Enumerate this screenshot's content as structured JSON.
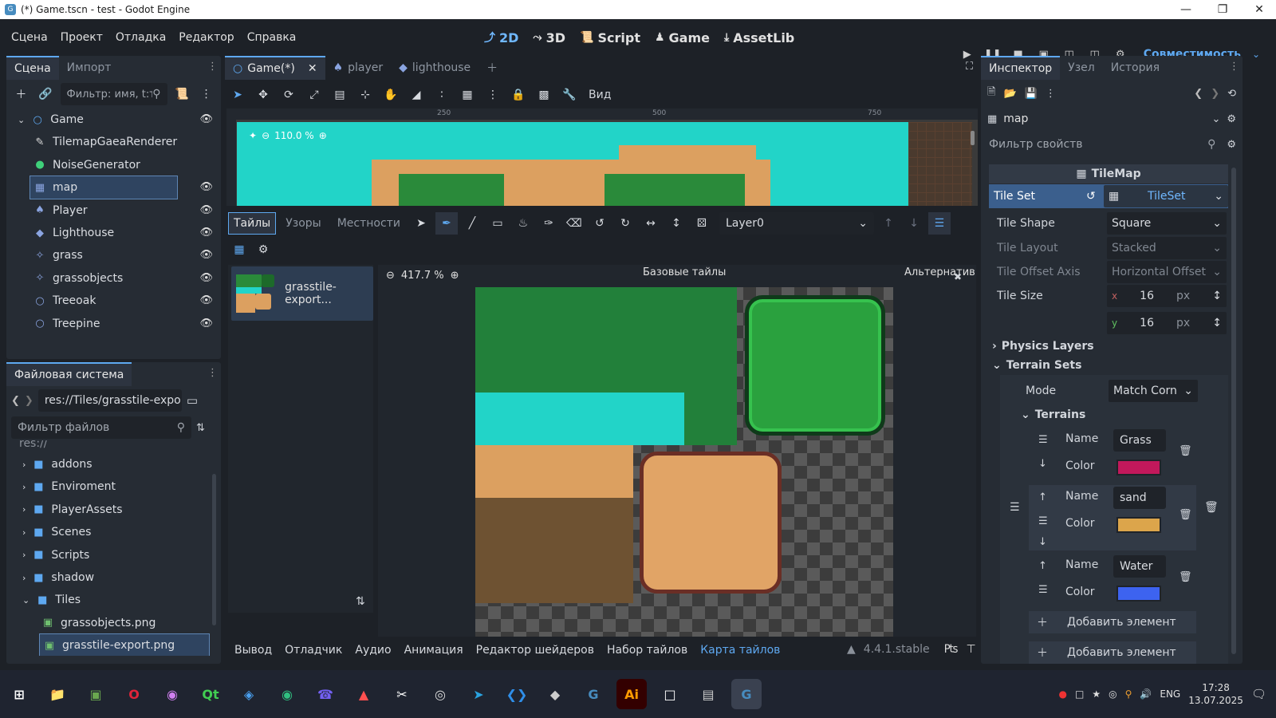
{
  "window": {
    "title": "(*) Game.tscn - test - Godot Engine"
  },
  "menu": {
    "items": [
      "Сцена",
      "Проект",
      "Отладка",
      "Редактор",
      "Справка"
    ]
  },
  "workspaces": [
    {
      "label": "2D",
      "icon": "2d-icon"
    },
    {
      "label": "3D",
      "icon": "3d-icon"
    },
    {
      "label": "Script",
      "icon": "script-icon"
    },
    {
      "label": "Game",
      "icon": "game-icon"
    },
    {
      "label": "AssetLib",
      "icon": "assetlib-icon"
    }
  ],
  "renderer": "Совместимость",
  "scene_panel": {
    "tabs": [
      "Сцена",
      "Импорт"
    ],
    "filter_placeholder": "Фильтр: имя, t:т",
    "nodes": [
      {
        "name": "Game",
        "depth": 0
      },
      {
        "name": "TilemapGaeaRenderer",
        "depth": 1
      },
      {
        "name": "NoiseGenerator",
        "depth": 1
      },
      {
        "name": "map",
        "depth": 1,
        "selected": true
      },
      {
        "name": "Player",
        "depth": 1
      },
      {
        "name": "Lighthouse",
        "depth": 1
      },
      {
        "name": "grass",
        "depth": 1
      },
      {
        "name": "grassobjects",
        "depth": 1
      },
      {
        "name": "Treeoak",
        "depth": 1
      },
      {
        "name": "Treepine",
        "depth": 1
      }
    ]
  },
  "filesystem": {
    "title": "Файловая система",
    "path": "res://Tiles/grasstile-export.",
    "filter_placeholder": "Фильтр файлов",
    "root": "res://",
    "items": [
      {
        "name": "addons",
        "type": "folder"
      },
      {
        "name": "Enviroment",
        "type": "folder"
      },
      {
        "name": "PlayerAssets",
        "type": "folder"
      },
      {
        "name": "Scenes",
        "type": "folder"
      },
      {
        "name": "Scripts",
        "type": "folder"
      },
      {
        "name": "shadow",
        "type": "folder"
      },
      {
        "name": "Tiles",
        "type": "folder"
      },
      {
        "name": "grassobjects.png",
        "type": "file"
      },
      {
        "name": "grasstile-export.png",
        "type": "file",
        "selected": true
      }
    ]
  },
  "editor_tabs": [
    "Game(*)",
    "player",
    "lighthouse"
  ],
  "toolbar": {
    "view_label": "Вид"
  },
  "viewport": {
    "zoom": "110.0 %",
    "ruler_marks": [
      "250",
      "500",
      "750"
    ]
  },
  "tilemap_panel": {
    "tabs": [
      "Тайлы",
      "Узоры",
      "Местности"
    ],
    "layer": "Layer0",
    "atlas_name": "grasstile-export...",
    "zoom": "417.7 %",
    "base_tiles_label": "Базовые тайлы",
    "alt_tiles_label": "Альтернативы"
  },
  "bottom_tabs": [
    "Вывод",
    "Отладчик",
    "Аудио",
    "Анимация",
    "Редактор шейдеров",
    "Набор тайлов",
    "Карта тайлов"
  ],
  "version": "4.4.1.stable",
  "inspector": {
    "tabs": [
      "Инспектор",
      "Узел",
      "История"
    ],
    "node": "map",
    "filter_placeholder": "Фильтр свойств",
    "class": "TileMap",
    "tile_set_label": "Tile Set",
    "tile_set_value": "TileSet",
    "props": [
      {
        "label": "Tile Shape",
        "value": "Square",
        "dim": false
      },
      {
        "label": "Tile Layout",
        "value": "Stacked",
        "dim": true
      },
      {
        "label": "Tile Offset Axis",
        "value": "Horizontal Offset",
        "dim": true
      }
    ],
    "tile_size_label": "Tile Size",
    "tile_size_x": "16",
    "tile_size_y": "16",
    "unit": "px",
    "physics_layers": "Physics Layers",
    "terrain_sets": "Terrain Sets",
    "mode_label": "Mode",
    "mode_value": "Match Corn",
    "terrains_label": "Terrains",
    "terrains": [
      {
        "name": "Grass",
        "color": "#c2185b"
      },
      {
        "name": "sand",
        "color": "#dca54b"
      },
      {
        "name": "Water",
        "color": "#3d63f0"
      }
    ],
    "name_label": "Name",
    "color_label": "Color",
    "add_label": "Добавить элемент"
  },
  "taskbar": {
    "lang": "ENG",
    "time": "17:28",
    "date": "13.07.2025"
  }
}
